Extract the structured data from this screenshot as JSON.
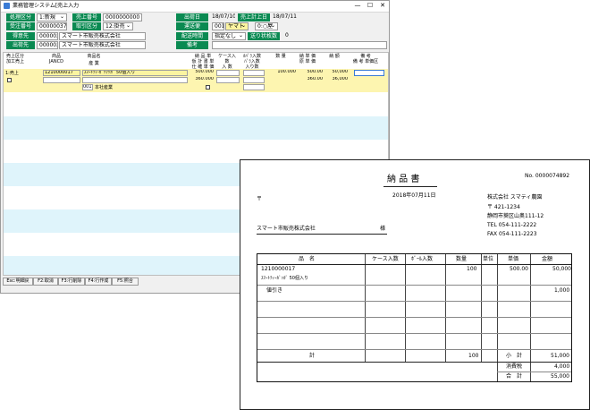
{
  "window": {
    "title": "業務管理システム[売上入力",
    "controls": [
      "—",
      "☐",
      "✕"
    ]
  },
  "header_form": {
    "left": [
      {
        "label": "処理区分",
        "value": "1:新規"
      },
      {
        "label": "売上番号",
        "value": "0000000000"
      },
      {
        "label": "受注番号",
        "value": "0000003727"
      },
      {
        "label": "取引区分",
        "value": "12:掛売"
      },
      {
        "label": "得意先",
        "code": "000002",
        "value": "スマート市販売株式会社"
      },
      {
        "label": "出荷先",
        "code": "000002",
        "value": "スマート市販売株式会社"
      }
    ],
    "right": [
      {
        "label": "出荷日",
        "value": "18/07/10"
      },
      {
        "label": "売上計上日",
        "value": "18/07/11"
      },
      {
        "label": "運送便",
        "code": "001",
        "value": "ヤマト",
        "extra": "0:○屋"
      },
      {
        "label": "配送時間",
        "value": "指定なし",
        "extra_label": "送り状枚数",
        "extra_value": "0"
      },
      {
        "label": "備考",
        "value": ""
      }
    ]
  },
  "grid": {
    "headers": {
      "kubun": "売上区分\n加工売上",
      "code": "商品\nJANCD",
      "name": "商品名",
      "name2": "産 業",
      "tanka": "納 品 単\n仮 計 書 単\n仕 確 単 価",
      "case": "ケース入数\n入 数",
      "bara": "ｶﾊﾞﾗ入数\nﾊﾞﾗ入数\n入り数",
      "qty": "数 量",
      "nohin": "納 単 価\n原 単 価",
      "kin": "納 額",
      "biko": "備 考\n備 考 単価区",
      "biko2": "考\n単価区"
    },
    "row": {
      "kubun": "1:売上",
      "code": "1210000017",
      "name": "ｽﾏｰﾄﾃｨ-ｶﾞｯｸｯｶﾞ 50個入り",
      "tanka1": "500.000",
      "tanka2": "360.000",
      "qty": "100.000",
      "nohin1": "500.00",
      "nohin2": "360.00",
      "kin1": "50,000",
      "kin2": "36,000",
      "sangyo_code": "001",
      "sangyo_name": "本社産業"
    }
  },
  "function_keys": [
    "Esc:明細戻",
    "F2:取消",
    "F3:行削除",
    "F4:行作成",
    "F5:照合"
  ],
  "delivery_note": {
    "title": "納 品 書",
    "number": "No. 0000074892",
    "postal_mark": "〒",
    "date": "2018年07月11日",
    "company": "株式会社 スマティ農園",
    "postal": "〒 421-1234",
    "address": "静岡市葵区山奥111-12",
    "tel": "TEL 054-111-2222",
    "fax": "FAX 054-111-2223",
    "customer": "スマート市販売株式会社",
    "customer_suffix": "様",
    "columns": [
      "品　名",
      "ケース入数",
      "ﾎﾞｰﾙ入数",
      "数量",
      "単位",
      "単価",
      "金額"
    ],
    "item_code": "1210000017",
    "item_name": "ｽﾏｰﾄﾃｨｰｶﾞｯｶﾞ 50個入り",
    "item_qty": "100",
    "item_price": "500.00",
    "item_amount": "50,000",
    "discount_label": "値引き",
    "discount_amount": "1,000",
    "total_label": "計",
    "total_qty": "100",
    "subtotal_label": "小　計",
    "subtotal": "51,000",
    "tax_label": "消費税",
    "tax": "4,000",
    "grand_label": "合　計",
    "grand_total": "55,000"
  }
}
